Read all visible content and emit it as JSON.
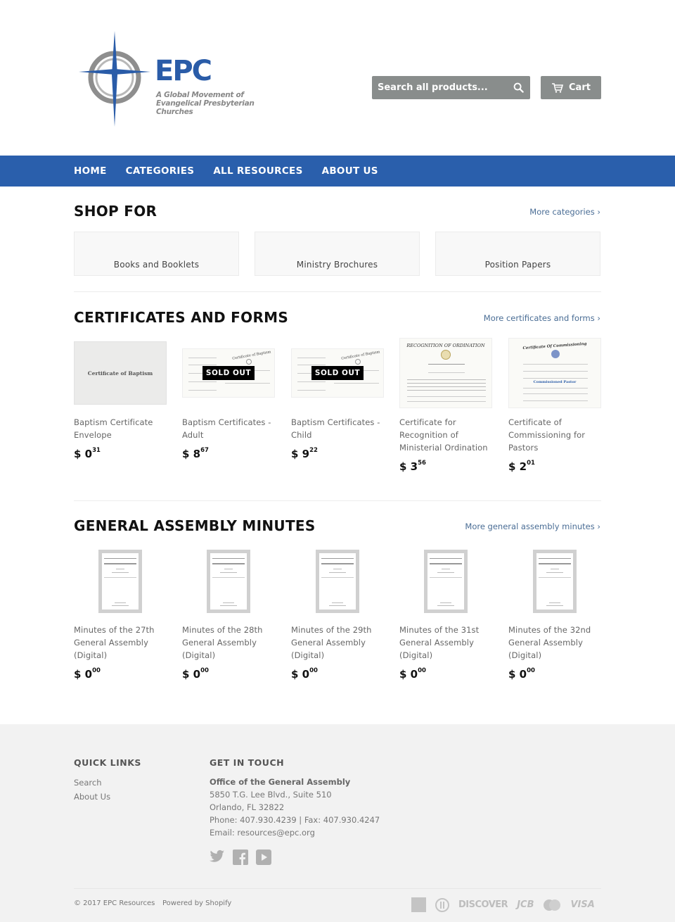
{
  "header": {
    "logo_text": "EPC",
    "logo_tagline_1": "A Global Movement of",
    "logo_tagline_2": "Evangelical Presbyterian Churches",
    "search_placeholder": "Search all products...",
    "cart_label": "Cart"
  },
  "nav": {
    "items": [
      {
        "label": "HOME"
      },
      {
        "label": "CATEGORIES"
      },
      {
        "label": "ALL RESOURCES"
      },
      {
        "label": "ABOUT US"
      }
    ]
  },
  "shop_for": {
    "title": "SHOP FOR",
    "more_link": "More categories ›",
    "categories": [
      {
        "label": "Books and Booklets"
      },
      {
        "label": "Ministry Brochures"
      },
      {
        "label": "Position Papers"
      }
    ]
  },
  "certificates": {
    "title": "CERTIFICATES AND FORMS",
    "more_link": "More certificates and forms ›",
    "products": [
      {
        "name": "Baptism Certificate Envelope",
        "currency": "$",
        "price_whole": "0",
        "price_cents": "31",
        "sold_out": false,
        "image_text": "Certificate of Baptism"
      },
      {
        "name": "Baptism Certificates - Adult",
        "currency": "$",
        "price_whole": "8",
        "price_cents": "67",
        "sold_out": true,
        "image_text": "Certificate of Baptism"
      },
      {
        "name": "Baptism Certificates - Child",
        "currency": "$",
        "price_whole": "9",
        "price_cents": "22",
        "sold_out": true,
        "image_text": "Certificate of Baptism"
      },
      {
        "name": "Certificate for Recognition of Ministerial Ordination",
        "currency": "$",
        "price_whole": "3",
        "price_cents": "56",
        "sold_out": false,
        "image_text": "RECOGNITION OF ORDINATION"
      },
      {
        "name": "Certificate of Commissioning for Pastors",
        "currency": "$",
        "price_whole": "2",
        "price_cents": "01",
        "sold_out": false,
        "image_text": "Certificate Of Commissioning"
      }
    ],
    "sold_out_label": "SOLD OUT"
  },
  "minutes": {
    "title": "GENERAL ASSEMBLY MINUTES",
    "more_link": "More general assembly minutes ›",
    "products": [
      {
        "name": "Minutes of the 27th General Assembly (Digital)",
        "currency": "$",
        "price_whole": "0",
        "price_cents": "00"
      },
      {
        "name": "Minutes of the 28th General Assembly (Digital)",
        "currency": "$",
        "price_whole": "0",
        "price_cents": "00"
      },
      {
        "name": "Minutes of the 29th General Assembly (Digital)",
        "currency": "$",
        "price_whole": "0",
        "price_cents": "00"
      },
      {
        "name": "Minutes of the 31st General Assembly (Digital)",
        "currency": "$",
        "price_whole": "0",
        "price_cents": "00"
      },
      {
        "name": "Minutes of the 32nd General Assembly (Digital)",
        "currency": "$",
        "price_whole": "0",
        "price_cents": "00"
      }
    ]
  },
  "footer": {
    "quick_links_title": "QUICK LINKS",
    "quick_links": [
      {
        "label": "Search"
      },
      {
        "label": "About Us"
      }
    ],
    "contact_title": "GET IN TOUCH",
    "office": "Office of the General Assembly",
    "address_1": "5850 T.G. Lee Blvd., Suite 510",
    "address_2": "Orlando, FL 32822",
    "phone_fax": "Phone: 407.930.4239 | Fax: 407.930.4247",
    "email": "Email: resources@epc.org",
    "social": [
      "twitter-icon",
      "facebook-icon",
      "youtube-icon"
    ],
    "copyright": "© 2017 EPC Resources",
    "powered_by": "Powered by Shopify",
    "payments": {
      "discover": "DISCOVER",
      "jcb": "JCB",
      "visa": "VISA"
    }
  },
  "colors": {
    "brand_blue": "#2a5fac",
    "button_gray": "#898d8c",
    "link_blue": "#4a6d95",
    "footer_bg": "#f2f2f2"
  }
}
